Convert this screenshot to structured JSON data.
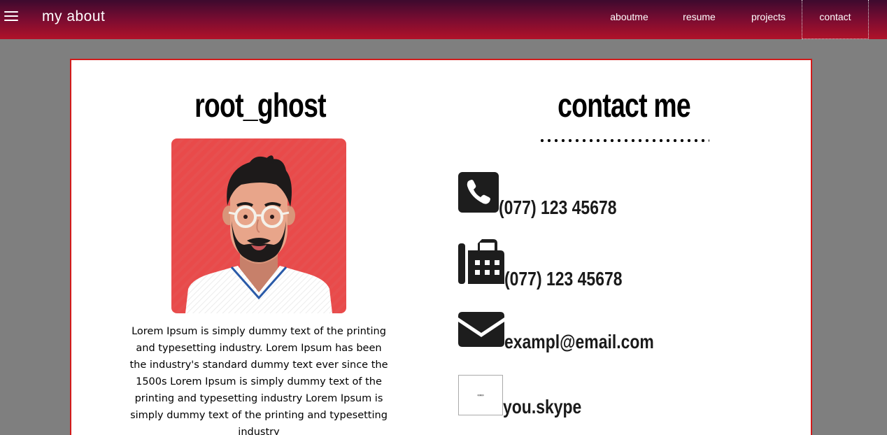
{
  "navbar": {
    "brand": "my about",
    "links": [
      "aboutme",
      "resume",
      "projects",
      "contact"
    ]
  },
  "profile": {
    "name": "root_ghost",
    "bio": "Lorem Ipsum is simply dummy text of the printing and typesetting industry. Lorem Ipsum has been the industry's standard dummy text ever since the 1500s Lorem Ipsum is simply dummy text of the printing and typesetting industry Lorem Ipsum is simply dummy text of the printing and typesetting industry"
  },
  "contact": {
    "title": "contact me",
    "items": [
      {
        "icon": "phone-icon",
        "text": "(077) 123 45678"
      },
      {
        "icon": "fax-icon",
        "text": "(077) 123 45678"
      },
      {
        "icon": "envelope-icon",
        "text": "exampl@email.com"
      },
      {
        "icon": "broken-image-icon",
        "text": "you.skype"
      }
    ]
  },
  "colors": {
    "card_border": "#d21a1a",
    "avatar_bg": "#e94a4a",
    "page_bg": "#7f7f7f"
  }
}
